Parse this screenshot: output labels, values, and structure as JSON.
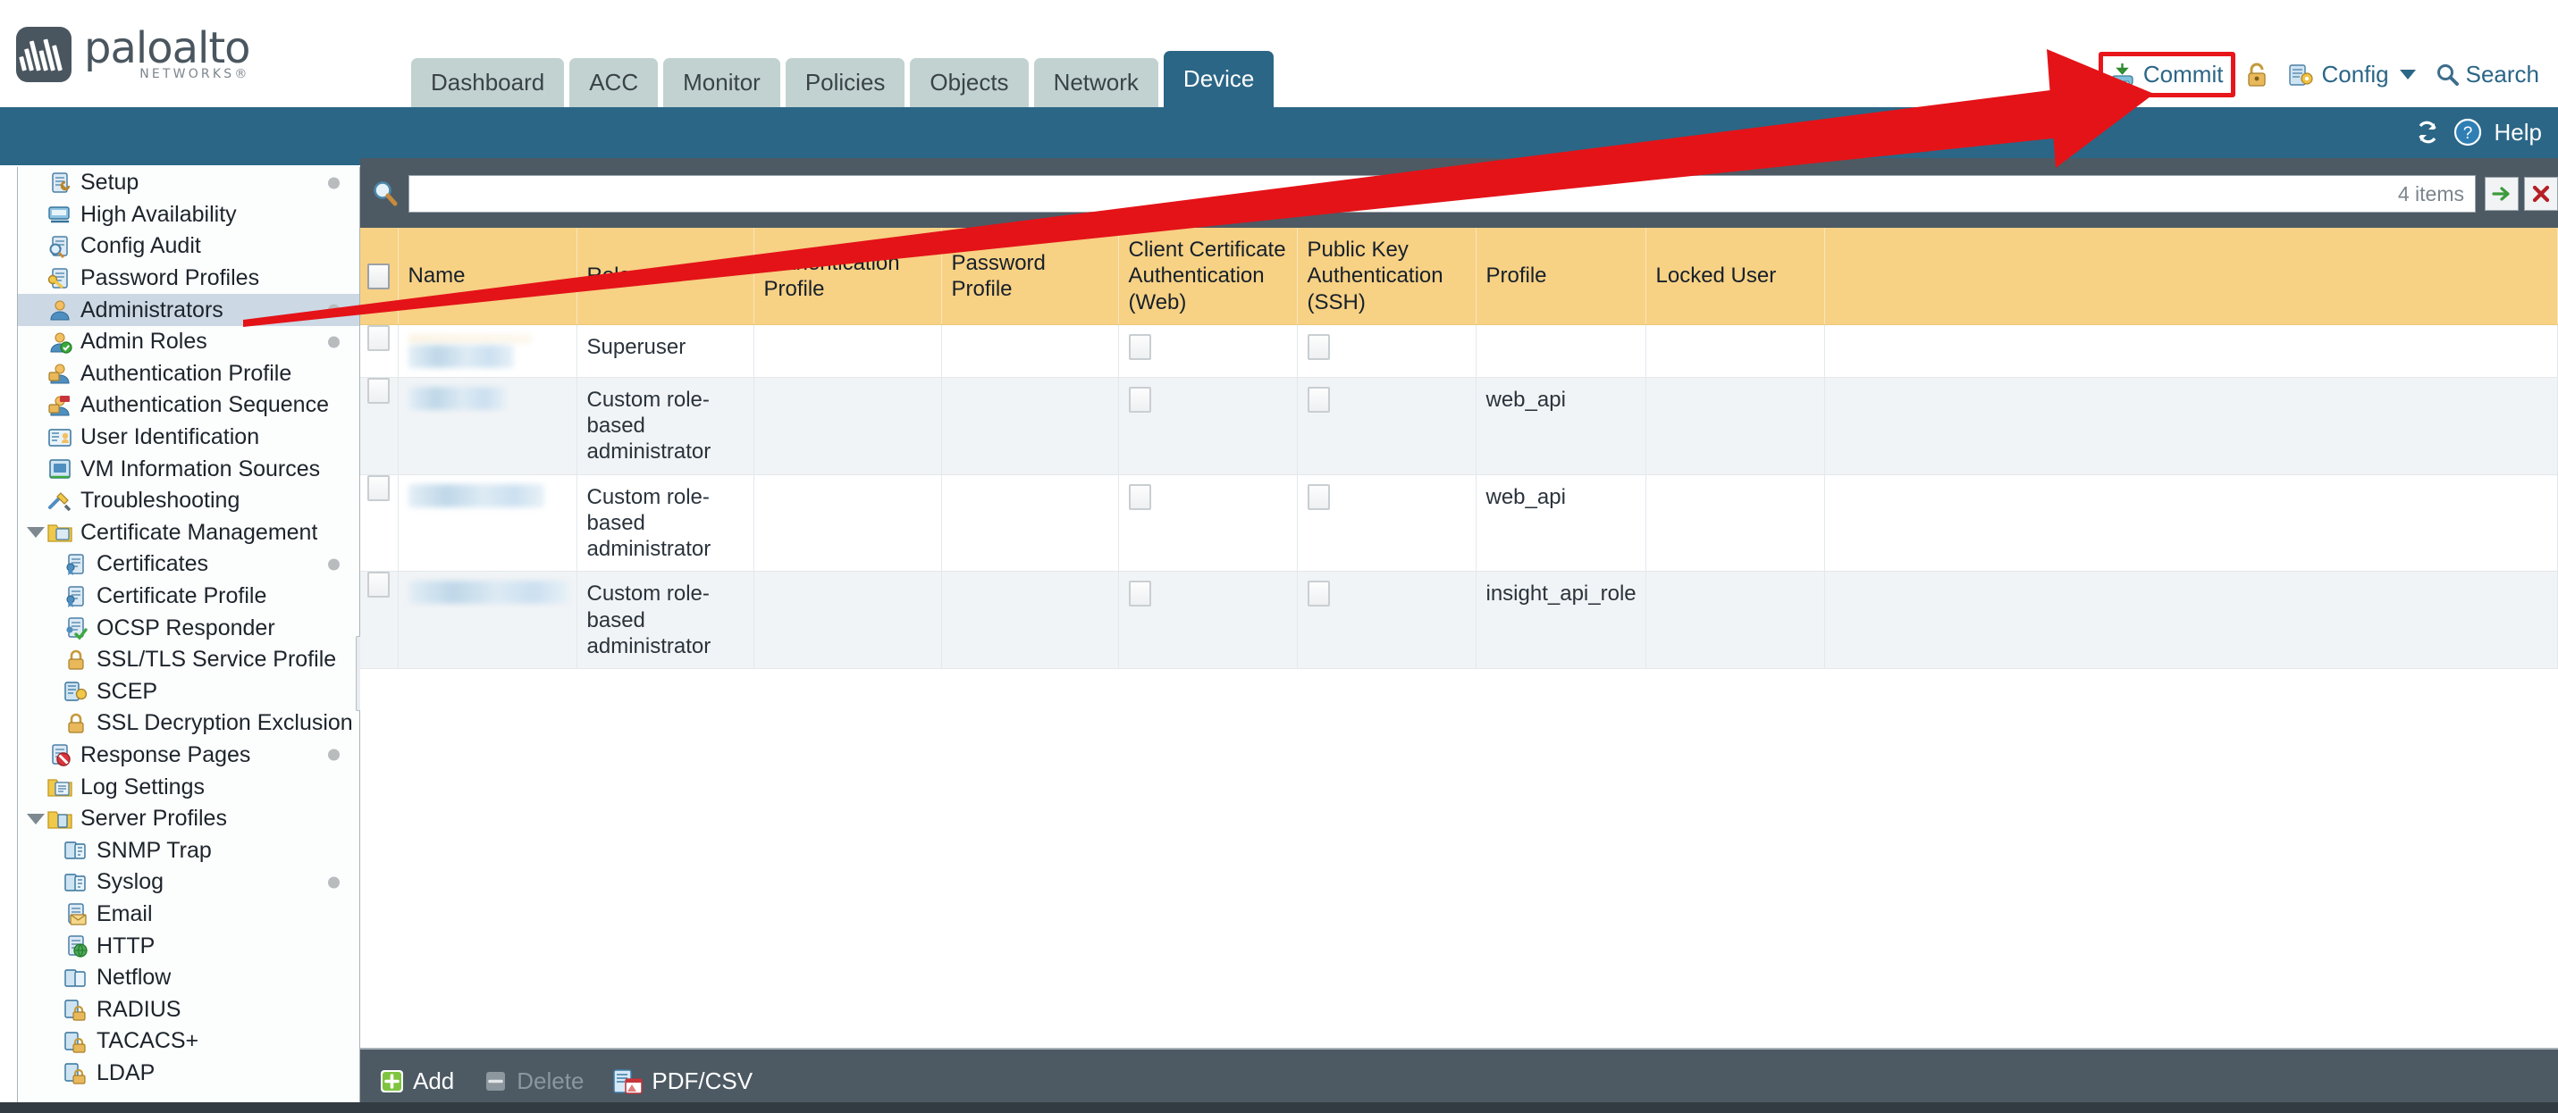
{
  "brand": {
    "name": "paloalto",
    "sub": "NETWORKS",
    "reg": "®"
  },
  "tabs": [
    {
      "label": "Dashboard",
      "active": false
    },
    {
      "label": "ACC",
      "active": false
    },
    {
      "label": "Monitor",
      "active": false
    },
    {
      "label": "Policies",
      "active": false
    },
    {
      "label": "Objects",
      "active": false
    },
    {
      "label": "Network",
      "active": false
    },
    {
      "label": "Device",
      "active": true
    }
  ],
  "header_actions": {
    "commit": "Commit",
    "config": "Config",
    "search": "Search",
    "lock_icon": "lock-icon",
    "commit_icon": "commit-icon",
    "config_icon": "config-icon",
    "search_icon": "search-icon"
  },
  "band": {
    "refresh_icon": "refresh-icon",
    "help": "Help",
    "help_icon": "help-icon"
  },
  "sidebar": {
    "items": [
      {
        "label": "Setup",
        "icon": "setup-wrench-icon",
        "child": false,
        "expander": false,
        "dot": true,
        "selected": false
      },
      {
        "label": "High Availability",
        "icon": "high-availability-icon",
        "child": false,
        "expander": false,
        "dot": false,
        "selected": false
      },
      {
        "label": "Config Audit",
        "icon": "config-audit-icon",
        "child": false,
        "expander": false,
        "dot": false,
        "selected": false
      },
      {
        "label": "Password Profiles",
        "icon": "password-profiles-key-icon",
        "child": false,
        "expander": false,
        "dot": false,
        "selected": false
      },
      {
        "label": "Administrators",
        "icon": "administrators-user-icon",
        "child": false,
        "expander": false,
        "dot": true,
        "selected": true
      },
      {
        "label": "Admin Roles",
        "icon": "admin-roles-icon",
        "child": false,
        "expander": false,
        "dot": true,
        "selected": false
      },
      {
        "label": "Authentication Profile",
        "icon": "authentication-profile-icon",
        "child": false,
        "expander": false,
        "dot": false,
        "selected": false
      },
      {
        "label": "Authentication Sequence",
        "icon": "authentication-sequence-icon",
        "child": false,
        "expander": false,
        "dot": false,
        "selected": false
      },
      {
        "label": "User Identification",
        "icon": "user-identification-icon",
        "child": false,
        "expander": false,
        "dot": false,
        "selected": false
      },
      {
        "label": "VM Information Sources",
        "icon": "vm-information-sources-icon",
        "child": false,
        "expander": false,
        "dot": false,
        "selected": false
      },
      {
        "label": "Troubleshooting",
        "icon": "troubleshooting-tools-icon",
        "child": false,
        "expander": false,
        "dot": false,
        "selected": false
      },
      {
        "label": "Certificate Management",
        "icon": "certificate-management-folder-icon",
        "child": false,
        "expander": true,
        "dot": false,
        "selected": false
      },
      {
        "label": "Certificates",
        "icon": "certificate-icon",
        "child": true,
        "expander": false,
        "dot": true,
        "selected": false
      },
      {
        "label": "Certificate Profile",
        "icon": "certificate-profile-icon",
        "child": true,
        "expander": false,
        "dot": false,
        "selected": false
      },
      {
        "label": "OCSP Responder",
        "icon": "ocsp-responder-icon",
        "child": true,
        "expander": false,
        "dot": false,
        "selected": false
      },
      {
        "label": "SSL/TLS Service Profile",
        "icon": "padlock-icon",
        "child": true,
        "expander": false,
        "dot": false,
        "selected": false
      },
      {
        "label": "SCEP",
        "icon": "scep-icon",
        "child": true,
        "expander": false,
        "dot": false,
        "selected": false
      },
      {
        "label": "SSL Decryption Exclusion",
        "icon": "padlock-icon",
        "child": true,
        "expander": false,
        "dot": false,
        "selected": false
      },
      {
        "label": "Response Pages",
        "icon": "response-pages-icon",
        "child": false,
        "expander": false,
        "dot": true,
        "selected": false
      },
      {
        "label": "Log Settings",
        "icon": "log-settings-icon",
        "child": false,
        "expander": false,
        "dot": false,
        "selected": false
      },
      {
        "label": "Server Profiles",
        "icon": "server-profiles-folder-icon",
        "child": false,
        "expander": true,
        "dot": false,
        "selected": false
      },
      {
        "label": "SNMP Trap",
        "icon": "snmp-trap-icon",
        "child": true,
        "expander": false,
        "dot": false,
        "selected": false
      },
      {
        "label": "Syslog",
        "icon": "syslog-icon",
        "child": true,
        "expander": false,
        "dot": true,
        "selected": false
      },
      {
        "label": "Email",
        "icon": "email-icon",
        "child": true,
        "expander": false,
        "dot": false,
        "selected": false
      },
      {
        "label": "HTTP",
        "icon": "http-globe-icon",
        "child": true,
        "expander": false,
        "dot": false,
        "selected": false
      },
      {
        "label": "Netflow",
        "icon": "netflow-icon",
        "child": true,
        "expander": false,
        "dot": false,
        "selected": false
      },
      {
        "label": "RADIUS",
        "icon": "radius-lock-icon",
        "child": true,
        "expander": false,
        "dot": false,
        "selected": false
      },
      {
        "label": "TACACS+",
        "icon": "tacacs-lock-icon",
        "child": true,
        "expander": false,
        "dot": false,
        "selected": false
      },
      {
        "label": "LDAP",
        "icon": "ldap-lock-icon",
        "child": true,
        "expander": false,
        "dot": false,
        "selected": false
      }
    ]
  },
  "search": {
    "value": "",
    "placeholder": "",
    "items_count": "4 items",
    "apply_icon": "green-arrow-icon",
    "clear_icon": "red-x-icon"
  },
  "table": {
    "columns": [
      "Name",
      "Role",
      "Authentication Profile",
      "Password Profile",
      "Client Certificate Authentication (Web)",
      "Public Key Authentication (SSH)",
      "Profile",
      "Locked User",
      ""
    ],
    "rows": [
      {
        "name": "",
        "name_redacted": true,
        "name_width": 118,
        "role": "Superuser",
        "auth_profile": "",
        "password_profile": "",
        "client_cert_auth": false,
        "public_key_auth": false,
        "profile": "",
        "locked_user": ""
      },
      {
        "name": "",
        "name_redacted": true,
        "name_width": 110,
        "role": "Custom role-based administrator",
        "auth_profile": "",
        "password_profile": "",
        "client_cert_auth": false,
        "public_key_auth": false,
        "profile": "web_api",
        "locked_user": ""
      },
      {
        "name": "",
        "name_redacted": true,
        "name_width": 152,
        "role": "Custom role-based administrator",
        "auth_profile": "",
        "password_profile": "",
        "client_cert_auth": false,
        "public_key_auth": false,
        "profile": "web_api",
        "locked_user": ""
      },
      {
        "name": "",
        "name_redacted": true,
        "name_width": 180,
        "role": "Custom role-based administrator",
        "auth_profile": "",
        "password_profile": "",
        "client_cert_auth": false,
        "public_key_auth": false,
        "profile": "insight_api_role",
        "locked_user": ""
      }
    ]
  },
  "footer": {
    "add": "Add",
    "delete": "Delete",
    "pdfcsv": "PDF/CSV",
    "add_icon": "green-plus-icon",
    "delete_icon": "gray-minus-icon",
    "pdf_icon": "pdf-csv-icon"
  },
  "annotation": {
    "color": "#e8161b",
    "type": "arrow-pointing-to-commit"
  }
}
